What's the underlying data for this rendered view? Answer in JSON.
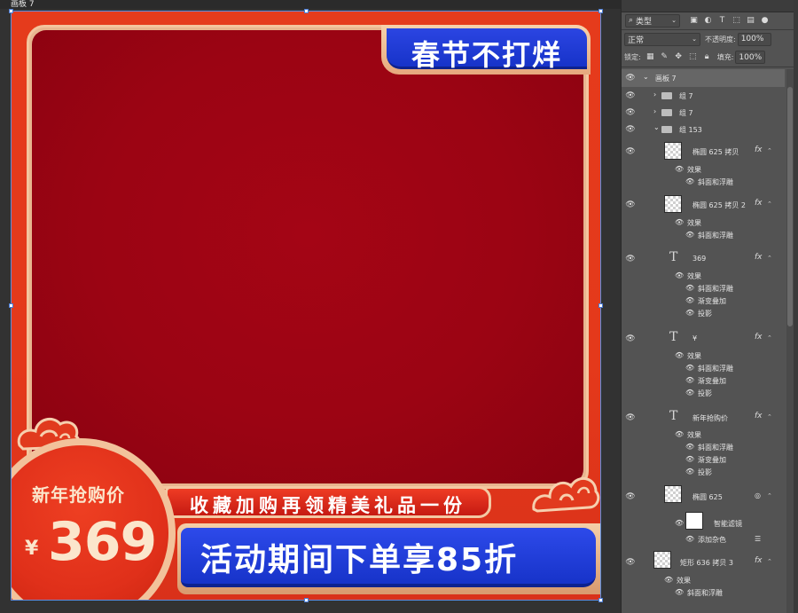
{
  "document": {
    "tab_title": "画板 7"
  },
  "artwork": {
    "top_banner": "春节不打烊",
    "ribbon_top": "收藏加购再领精美礼品一份",
    "ribbon_bottom": "活动期间下单享85折",
    "price_label": "新年抢购价",
    "currency": "¥",
    "price": "369"
  },
  "layers_panel": {
    "filter_label": "类型",
    "blend_mode": "正常",
    "opacity_label": "不透明度:",
    "opacity_value": "100%",
    "lock_label": "锁定:",
    "fill_label": "填充:",
    "fill_value": "100%",
    "artboard_name": "画板 7",
    "layers": [
      {
        "name": "组 7",
        "type": "group"
      },
      {
        "name": "组 7",
        "type": "group"
      },
      {
        "name": "组 153",
        "type": "group-open"
      },
      {
        "name": "椭圆 625 拷贝",
        "type": "shape",
        "fx": "fx",
        "effects": [
          "效果",
          "斜面和浮雕"
        ]
      },
      {
        "name": "椭圆 625 拷贝 2",
        "type": "shape",
        "fx": "fx",
        "effects": [
          "效果",
          "斜面和浮雕"
        ]
      },
      {
        "name": "369",
        "type": "text",
        "fx": "fx",
        "effects": [
          "效果",
          "斜面和浮雕",
          "渐变叠加",
          "投影"
        ]
      },
      {
        "name": "¥",
        "type": "text",
        "fx": "fx",
        "effects": [
          "效果",
          "斜面和浮雕",
          "渐变叠加",
          "投影"
        ]
      },
      {
        "name": "新年抢购价",
        "type": "text",
        "fx": "fx",
        "effects": [
          "效果",
          "斜面和浮雕",
          "渐变叠加",
          "投影"
        ]
      },
      {
        "name": "椭圆 625",
        "type": "smart",
        "effects": [
          "智能滤镜",
          "添加杂色"
        ]
      },
      {
        "name": "矩形 636 拷贝 3",
        "type": "shape",
        "fx": "fx",
        "effects": [
          "效果",
          "斜面和浮雕"
        ]
      }
    ]
  }
}
